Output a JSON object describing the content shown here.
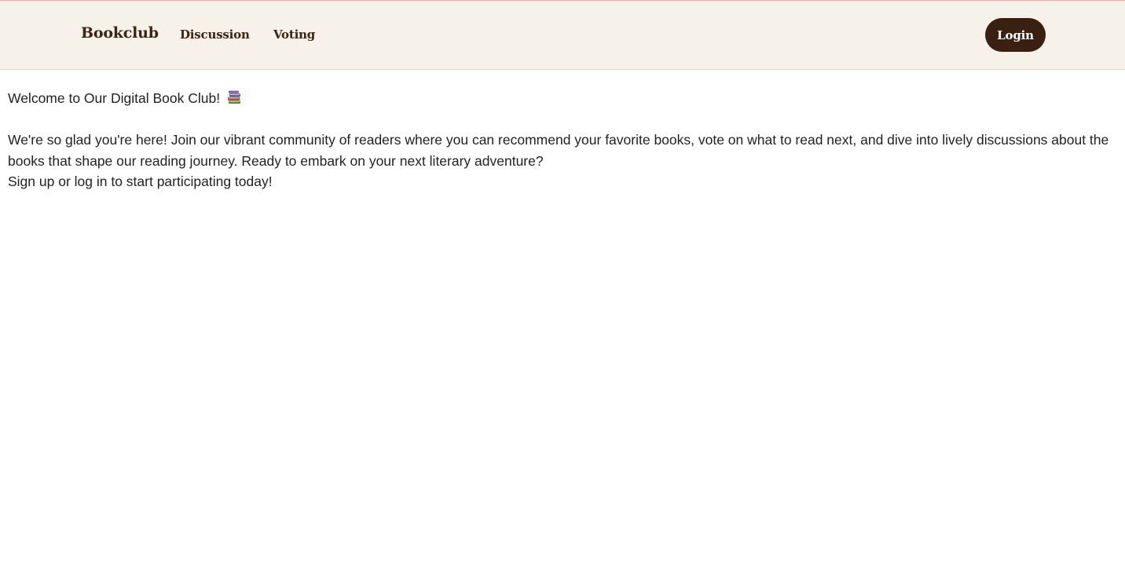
{
  "navbar": {
    "brand": "Bookclub",
    "links": [
      "Discussion",
      "Voting"
    ],
    "login_label": "Login"
  },
  "main": {
    "welcome_text": "Welcome to Our Digital Book Club!",
    "welcome_icon": "books-icon",
    "intro_text": "We're so glad you're here! Join our vibrant community of readers where you can recommend your favorite books, vote on what to read next, and dive into lively discussions about the books that shape our reading journey. Ready to embark on your next literary adventure?",
    "cta_text": "Sign up or log in to start participating today!"
  },
  "colors": {
    "navbar_bg": "#f6f2e9",
    "brand_text": "#3b2414",
    "login_button_bg": "#3a2011",
    "login_button_text": "#ffffff",
    "body_text": "#222222"
  }
}
